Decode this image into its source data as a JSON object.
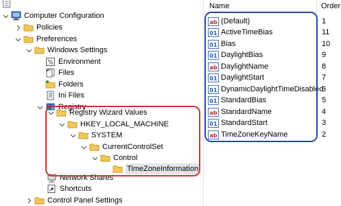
{
  "colors": {
    "left_callout": "#c7373a",
    "right_callout": "#1f4aa8",
    "folder": "#f0c85a",
    "folder_dark": "#c99b2a"
  },
  "tree": {
    "nodes": [
      {
        "key": "computer_configuration",
        "label": "Computer Configuration",
        "icon": "computer-icon",
        "chevron": "expanded"
      },
      {
        "key": "policies",
        "label": "Policies",
        "icon": "folder-icon",
        "chevron": "collapsed"
      },
      {
        "key": "preferences",
        "label": "Preferences",
        "icon": "folder-icon",
        "chevron": "expanded"
      },
      {
        "key": "windows_settings",
        "label": "Windows Settings",
        "icon": "folder-icon",
        "chevron": "expanded"
      },
      {
        "key": "environment",
        "label": "Environment",
        "icon": "environment-icon",
        "chevron": "none"
      },
      {
        "key": "files",
        "label": "Files",
        "icon": "files-icon",
        "chevron": "none"
      },
      {
        "key": "folders",
        "label": "Folders",
        "icon": "folder-icon",
        "chevron": "none"
      },
      {
        "key": "ini_files",
        "label": "Ini Files",
        "icon": "ini-file-icon",
        "chevron": "none"
      },
      {
        "key": "registry",
        "label": "Registry",
        "icon": "registry-icon",
        "chevron": "expanded"
      },
      {
        "key": "registry_wizard_values",
        "label": "Registry Wizard Values",
        "icon": "folder-icon",
        "chevron": "expanded"
      },
      {
        "key": "hkey_local_machine",
        "label": "HKEY_LOCAL_MACHINE",
        "icon": "folder-icon",
        "chevron": "expanded"
      },
      {
        "key": "system",
        "label": "SYSTEM",
        "icon": "folder-icon",
        "chevron": "expanded"
      },
      {
        "key": "current_control_set",
        "label": "CurrentControlSet",
        "icon": "folder-icon",
        "chevron": "expanded"
      },
      {
        "key": "control",
        "label": "Control",
        "icon": "folder-icon",
        "chevron": "expanded"
      },
      {
        "key": "time_zone_information",
        "label": "TimeZoneInformation",
        "icon": "folder-icon",
        "chevron": "none",
        "selected": true
      },
      {
        "key": "network_shares",
        "label": "Network Shares",
        "icon": "network-shares-icon",
        "chevron": "none"
      },
      {
        "key": "shortcuts",
        "label": "Shortcuts",
        "icon": "shortcut-icon",
        "chevron": "none"
      },
      {
        "key": "control_panel_settings",
        "label": "Control Panel Settings",
        "icon": "folder-icon",
        "chevron": "collapsed"
      }
    ]
  },
  "list": {
    "columns": {
      "name": "Name",
      "order": "Order"
    },
    "rows": [
      {
        "name": "(Default)",
        "order": "1"
      },
      {
        "name": "ActiveTimeBias",
        "order": "11"
      },
      {
        "name": "Bias",
        "order": "10"
      },
      {
        "name": "DaylightBias",
        "order": "9"
      },
      {
        "name": "DaylightName",
        "order": "8"
      },
      {
        "name": "DaylightStart",
        "order": "7"
      },
      {
        "name": "DynamicDaylightTimeDisabled",
        "order": "6"
      },
      {
        "name": "StandardBias",
        "order": "5"
      },
      {
        "name": "StandardName",
        "order": "4"
      },
      {
        "name": "StandardStart",
        "order": "3"
      },
      {
        "name": "TimeZoneKeyName",
        "order": "2"
      }
    ],
    "value_icon": "registry-value-icon"
  }
}
